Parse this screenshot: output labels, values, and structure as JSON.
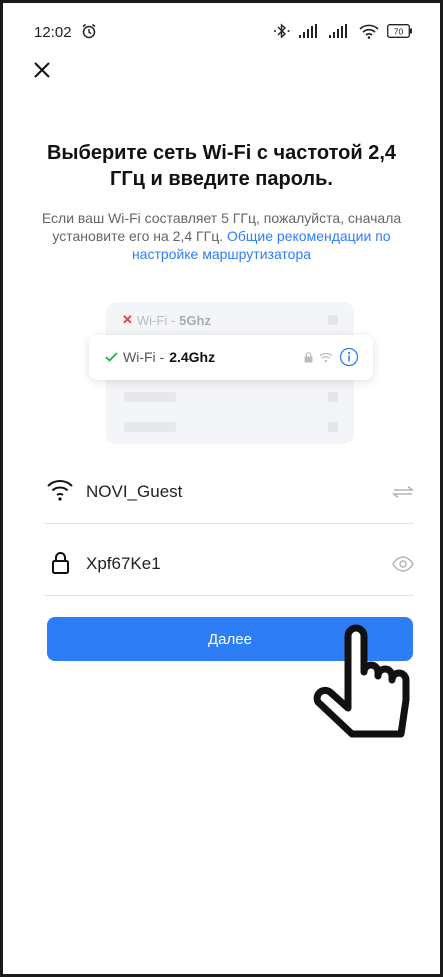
{
  "status_bar": {
    "time": "12:02",
    "battery": "70",
    "icons": [
      "alarm-icon",
      "bluetooth-icon",
      "signal-icon",
      "signal-icon",
      "wifi-icon",
      "battery-icon"
    ]
  },
  "header": {
    "close_icon": "close-icon"
  },
  "title": "Выберите сеть Wi-Fi с частотой 2,4 ГГц и введите пароль.",
  "subtitle": {
    "text": "Если ваш Wi-Fi составляет 5 ГГц, пожалуйста, сначала установите его на 2,4 ГГц. ",
    "link": "Общие рекомендации по настройке маршрутизатора"
  },
  "illustration": {
    "row_5ghz": {
      "prefix": "Wi-Fi - ",
      "band": "5Ghz"
    },
    "row_24ghz": {
      "prefix": "Wi-Fi - ",
      "band": "2.4Ghz"
    }
  },
  "wifi_field": {
    "value": "NOVI_Guest",
    "icon": "wifi-icon",
    "action_icon": "switch-icon"
  },
  "password_field": {
    "value": "Xpf67Ke1",
    "icon": "lock-icon",
    "action_icon": "eye-icon"
  },
  "next_button": {
    "label": "Далее"
  },
  "colors": {
    "accent": "#2d7df6",
    "link": "#2e7dff",
    "error": "#ee3b3b",
    "success": "#21b04b"
  }
}
